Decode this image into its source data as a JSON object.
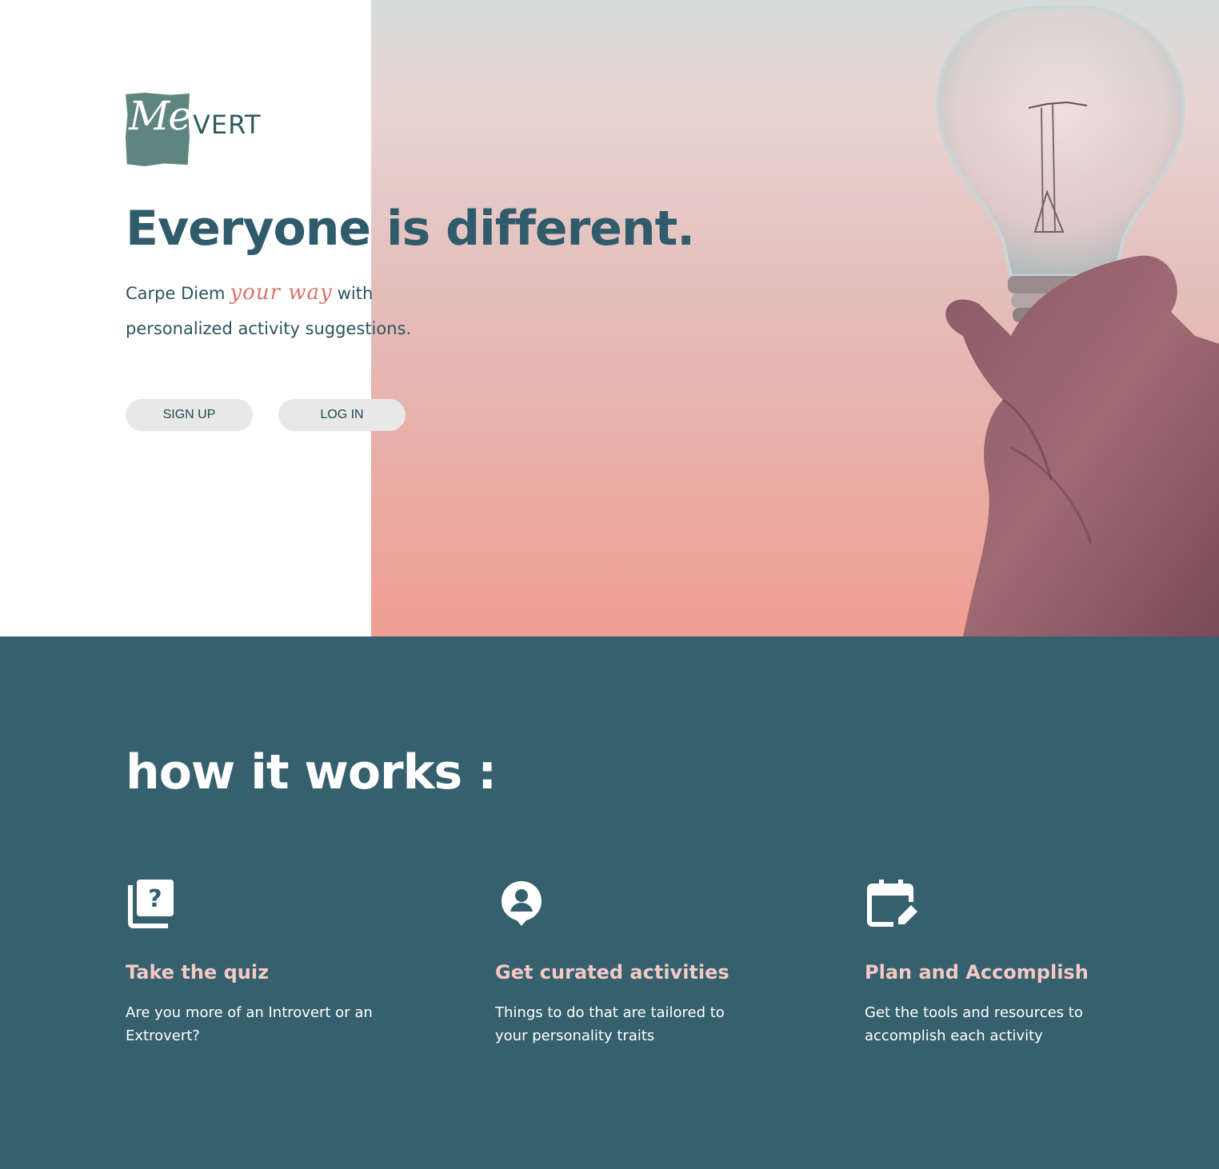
{
  "brand": {
    "logo_script": "Me",
    "logo_text": "VERT",
    "logo_color": "#5e8580"
  },
  "hero": {
    "headline": "Everyone is different.",
    "tagline_before": "Carpe Diem",
    "tagline_accent": "your way",
    "tagline_after": "with personalized activity suggestions.",
    "buttons": {
      "signup": "SIGN UP",
      "login": "LOG IN"
    },
    "photo_icon": "lightbulb-in-hand-photo"
  },
  "how_it_works": {
    "title": "how it works :",
    "steps": [
      {
        "icon": "quiz-icon",
        "title": "Take the quiz",
        "description": "Are you more of an Introvert or an Extrovert?"
      },
      {
        "icon": "person-pin-icon",
        "title": "Get curated activities",
        "description": "Things to do that are tailored to your personality traits"
      },
      {
        "icon": "calendar-edit-icon",
        "title": "Plan and Accomplish",
        "description": "Get the tools and resources to accomplish each activity"
      }
    ]
  },
  "colors": {
    "primary": "#36606e",
    "heading": "#2f5b6b",
    "accent_pink": "#d9736f",
    "step_title": "#f4c9c4",
    "button_bg": "#e8e8e8"
  }
}
